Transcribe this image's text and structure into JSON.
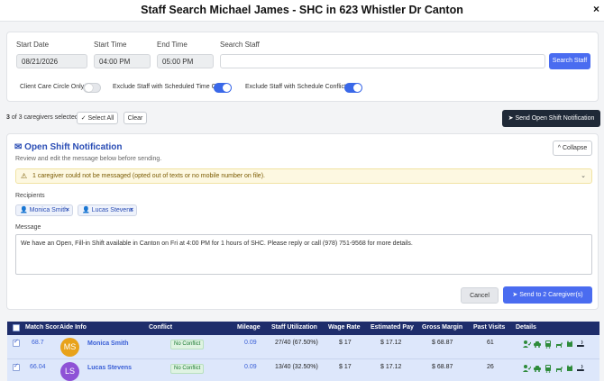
{
  "modal": {
    "title": "Staff Search Michael James - SHC in 623 Whistler Dr Canton",
    "close": "×"
  },
  "filters": {
    "start_date_label": "Start Date",
    "start_date": "08/21/2026",
    "start_time_label": "Start Time",
    "start_time": "04:00 PM",
    "end_time_label": "End Time",
    "end_time": "05:00 PM",
    "search_label": "Search Staff",
    "search_value": "",
    "search_button": "Search Staff",
    "toggles": [
      {
        "label": "Client Care Circle Only",
        "on": false
      },
      {
        "label": "Exclude Staff with Scheduled Time Off",
        "on": true
      },
      {
        "label": "Exclude Staff with Schedule Conflicts",
        "on": true
      }
    ]
  },
  "selection": {
    "count_bold": "3",
    "count_text": "of 3 caregivers selected",
    "select_all": "Select All",
    "clear": "Clear",
    "send_open_shift": "Send Open Shift Notification"
  },
  "notification": {
    "title": "Open Shift Notification",
    "subtitle": "Review and edit the message below before sending.",
    "collapse": "Collapse",
    "warning": "1 caregiver could not be messaged (opted out of texts or no mobile number on file).",
    "recipients_label": "Recipients",
    "recipients": [
      "Monica Smith",
      "Lucas Stevens"
    ],
    "message_label": "Message",
    "message": "We have an Open, Fill-in Shift available in Canton on Fri at 4:00 PM for 1 hours of SHC. Please reply or call (978) 751-9568 for more details.",
    "cancel": "Cancel",
    "send": "Send to 2 Caregiver(s)"
  },
  "table": {
    "headers": [
      "Match Score",
      "Aide Info",
      "Conflict",
      "Mileage",
      "Staff Utilization",
      "Wage Rate",
      "Estimated Pay",
      "Gross Margin",
      "Past Visits",
      "Details"
    ],
    "rows": [
      {
        "score": "68.7",
        "initials": "MS",
        "avatar_color": "#e8a21a",
        "name": "Monica Smith",
        "conflict": "No Conflict",
        "mileage": "0.09",
        "utilization": "27/40 (67.50%)",
        "wage": "$ 17",
        "pay": "$ 17.12",
        "margin": "$ 68.87",
        "visits": "61"
      },
      {
        "score": "66.04",
        "initials": "LS",
        "avatar_color": "#8e52d6",
        "name": "Lucas Stevens",
        "conflict": "No Conflict",
        "mileage": "0.09",
        "utilization": "13/40 (32.50%)",
        "wage": "$ 17",
        "pay": "$ 17.12",
        "margin": "$ 68.87",
        "visits": "26"
      }
    ]
  },
  "colors": {
    "accent": "#4a6cf0",
    "header": "#1e2d6b",
    "icon_green": "#2e8b3a"
  }
}
